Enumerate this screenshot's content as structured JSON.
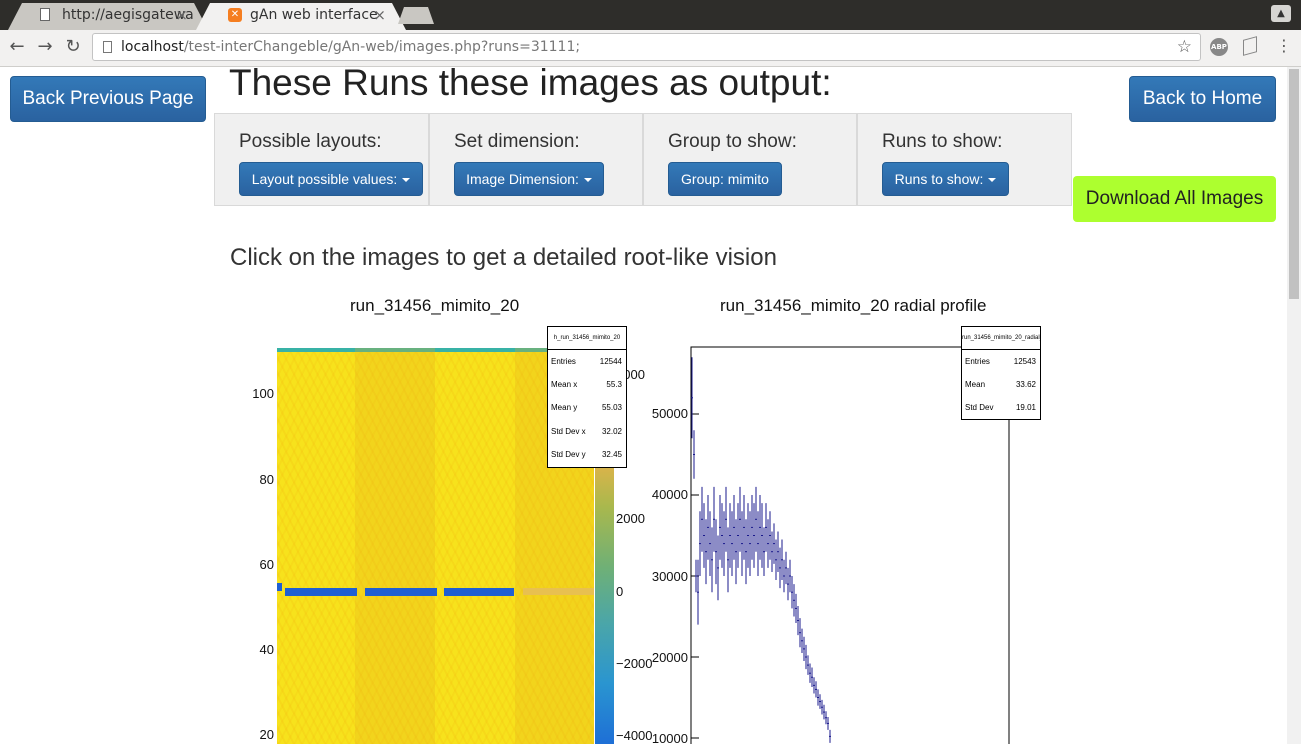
{
  "browser": {
    "tabs": [
      {
        "title": "http://aegisgatewa",
        "active": false
      },
      {
        "title": "gAn web interface",
        "active": true
      }
    ],
    "url_host": "localhost",
    "url_path": "/test-interChangeble/gAn-web/images.php?runs=31111;",
    "extension_abp": "ABP"
  },
  "page": {
    "back_previous": "Back Previous Page",
    "back_home": "Back to Home",
    "title": "These Runs these images as output:",
    "download_all": "Download All Images",
    "download_color": "#adff2f",
    "instructions": "Click on the images to get a detailed root-like vision",
    "panels": [
      {
        "label": "Possible layouts:",
        "button": "Layout possible values:",
        "has_caret": true
      },
      {
        "label": "Set dimension:",
        "button": "Image Dimension:",
        "has_caret": true
      },
      {
        "label": "Group to show:",
        "button": "Group: mimito",
        "has_caret": false
      },
      {
        "label": "Runs to show:",
        "button": "Runs to show:",
        "has_caret": true
      }
    ]
  },
  "plots": {
    "heatmap": {
      "title": "run_31456_mimito_20",
      "stats_title": "h_run_31456_mimito_20",
      "stats": [
        {
          "key": "Entries",
          "value": "12544"
        },
        {
          "key": "Mean x",
          "value": "55.3"
        },
        {
          "key": "Mean y",
          "value": "55.03"
        },
        {
          "key": "Std Dev x",
          "value": "32.02"
        },
        {
          "key": "Std Dev y",
          "value": "32.45"
        }
      ],
      "y_ticks": [
        "100",
        "80",
        "60",
        "40",
        "20"
      ],
      "z_ticks": [
        "4000",
        "2000",
        "0",
        "−2000",
        "−4000"
      ]
    },
    "radial": {
      "title": "run_31456_mimito_20 radial profile",
      "stats_title": "run_31456_mimito_20_radial_profile",
      "stats": [
        {
          "key": "Entries",
          "value": "12543"
        },
        {
          "key": "Mean",
          "value": "33.62"
        },
        {
          "key": "Std Dev",
          "value": "19.01"
        }
      ],
      "y_ticks": [
        "50000",
        "40000",
        "30000",
        "20000",
        "10000"
      ]
    }
  },
  "chart_data": {
    "type": "scatter",
    "title": "run_31456_mimito_20 radial profile",
    "ylim": [
      10000,
      57000
    ],
    "x": [
      0,
      1,
      2,
      3,
      4,
      5,
      6,
      7,
      8,
      9,
      10,
      11,
      12,
      13,
      14,
      15,
      16,
      17,
      18,
      19,
      20,
      21,
      22,
      23,
      24,
      25,
      26,
      27,
      28,
      29,
      30,
      31,
      32,
      33,
      34,
      35,
      36,
      37,
      38,
      39,
      40,
      41,
      42,
      43,
      44,
      45,
      46,
      47,
      48,
      49,
      50,
      51,
      52,
      53,
      54,
      55,
      56,
      57,
      58,
      59,
      60,
      61,
      62,
      63,
      64,
      65,
      66,
      67,
      68,
      69
    ],
    "values": [
      52000,
      45000,
      30000,
      28000,
      34000,
      37000,
      35000,
      33000,
      36000,
      34000,
      32000,
      37000,
      33000,
      31000,
      36000,
      35000,
      34000,
      37000,
      32000,
      35000,
      34000,
      36000,
      33000,
      35000,
      37000,
      34000,
      36000,
      33000,
      35000,
      34000,
      36000,
      35000,
      37000,
      34000,
      36000,
      35000,
      33000,
      36000,
      34000,
      35000,
      33000,
      34000,
      32000,
      33000,
      31000,
      32000,
      30000,
      31000,
      29000,
      30000,
      28000,
      27000,
      26000,
      24500,
      23000,
      22000,
      21000,
      20000,
      19000,
      18000,
      17500,
      16500,
      16000,
      15000,
      14500,
      13800,
      13200,
      12500,
      11800,
      10200
    ],
    "errors": [
      5000,
      3000,
      2000,
      4000,
      4000,
      4000,
      4000,
      4000,
      4000,
      4000,
      4000,
      4000,
      4000,
      4000,
      4000,
      4000,
      4000,
      4000,
      4000,
      4000,
      4000,
      4000,
      4000,
      4000,
      4000,
      4000,
      4000,
      4000,
      4000,
      4000,
      4000,
      4000,
      4000,
      4000,
      4000,
      4000,
      3000,
      3000,
      3000,
      3000,
      2500,
      2500,
      2500,
      2500,
      2500,
      2500,
      2000,
      2000,
      2000,
      2000,
      2000,
      2000,
      1800,
      1800,
      1800,
      1500,
      1500,
      1500,
      1200,
      1200,
      1200,
      1000,
      1000,
      1000,
      900,
      900,
      900,
      800,
      800,
      800
    ]
  }
}
